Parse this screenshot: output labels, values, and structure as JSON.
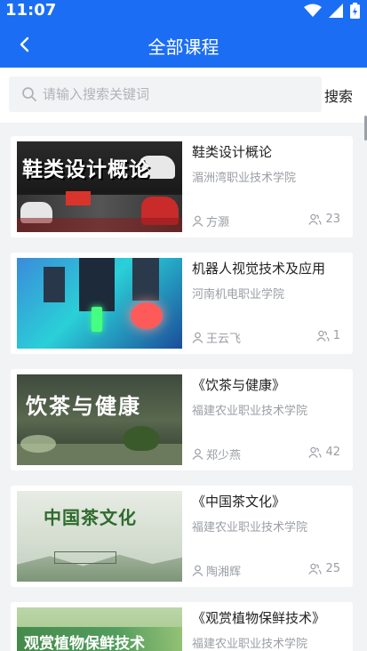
{
  "status_bar": {
    "time": "11:07"
  },
  "header": {
    "title": "全部课程"
  },
  "search": {
    "placeholder": "请输入搜索关键词",
    "button_label": "搜索"
  },
  "courses": [
    {
      "title": "鞋类设计概论",
      "school": "湄洲湾职业技术学院",
      "teacher": "方灏",
      "count": "23",
      "thumb_text": "鞋类设计概论"
    },
    {
      "title": "机器人视觉技术及应用",
      "school": "河南机电职业学院",
      "teacher": "王云飞",
      "count": "1"
    },
    {
      "title": "《饮茶与健康》",
      "school": "福建农业职业技术学院",
      "teacher": "郑少燕",
      "count": "42",
      "thumb_text": "饮茶与健康"
    },
    {
      "title": "《中国茶文化》",
      "school": "福建农业职业技术学院",
      "teacher": "陶湘辉",
      "count": "25",
      "thumb_text": "中国茶文化"
    },
    {
      "title": "《观赏植物保鲜技术》",
      "school": "福建农业职业技术学院",
      "thumb_text": "观赏植物保鲜技术"
    }
  ],
  "colors": {
    "primary": "#1b6ef3",
    "page_bg": "#f2f3f5",
    "muted_text": "#9a9ea4"
  }
}
